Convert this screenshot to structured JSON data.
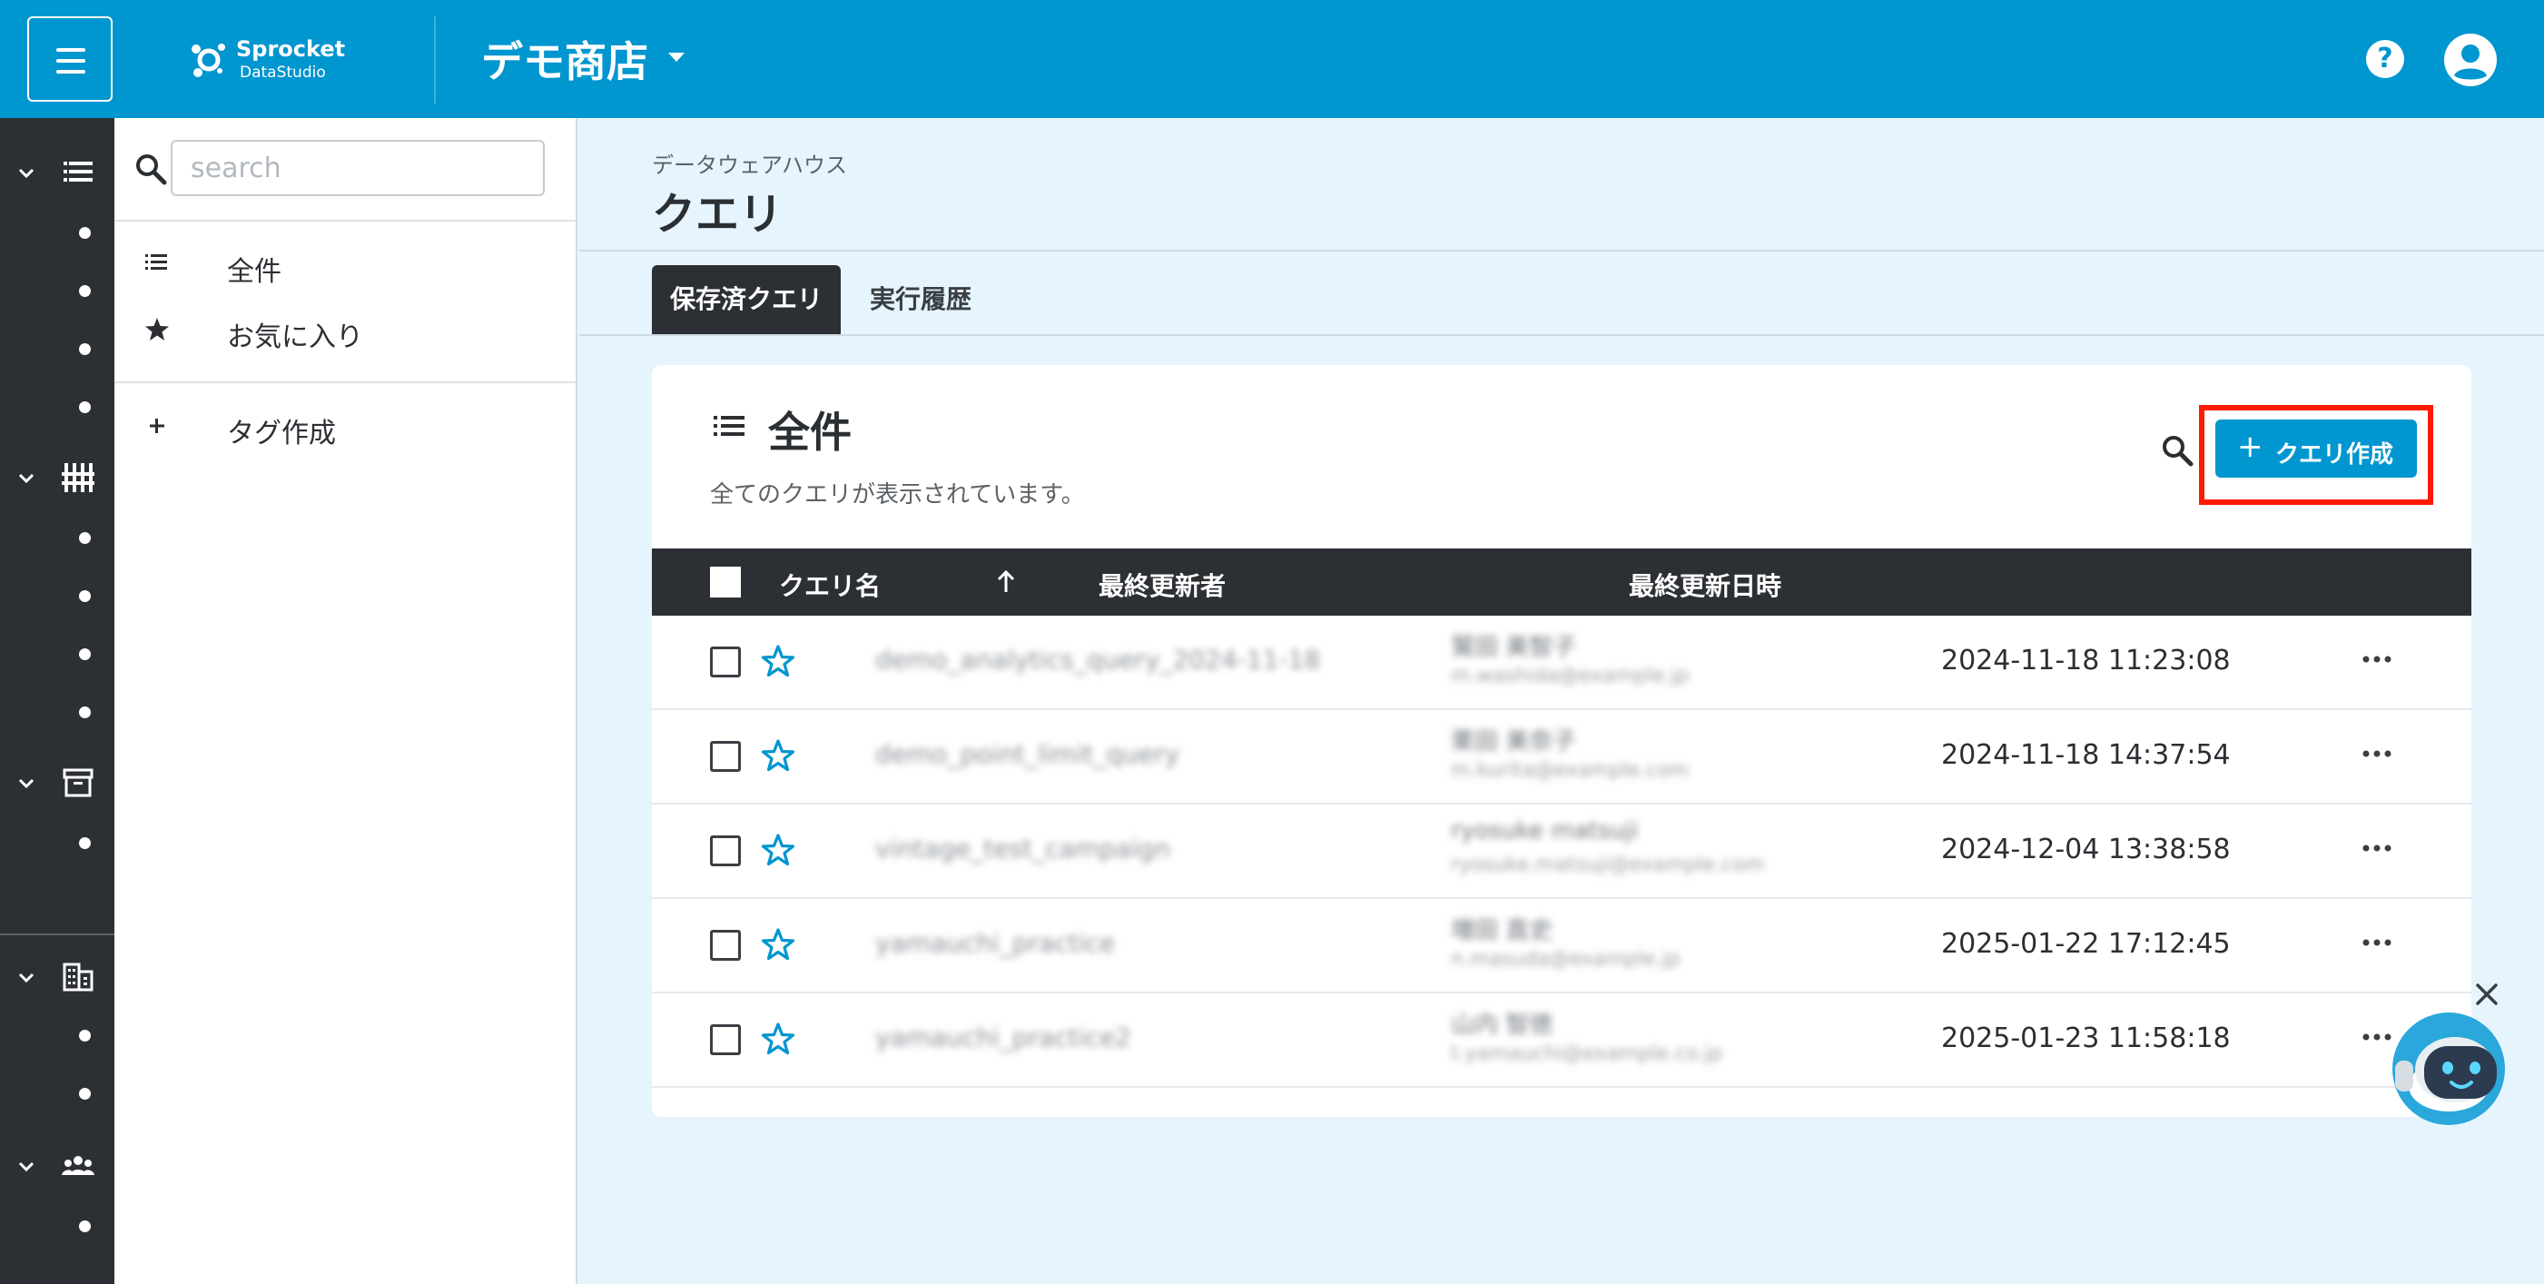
{
  "header": {
    "brand_name": "Sprocket",
    "brand_sub": "DataStudio",
    "store_name": "デモ商店",
    "help_symbol": "?"
  },
  "sidebar": {
    "search_placeholder": "search",
    "items": [
      {
        "label": "全件",
        "icon": "list-icon"
      },
      {
        "label": "お気に入り",
        "icon": "star-icon"
      },
      {
        "label": "タグ作成",
        "icon": "plus-icon"
      }
    ]
  },
  "page": {
    "breadcrumb": "データウェアハウス",
    "title": "クエリ",
    "tabs": [
      {
        "label": "保存済クエリ",
        "active": true
      },
      {
        "label": "実行履歴",
        "active": false
      }
    ]
  },
  "card": {
    "title": "全件",
    "description": "全てのクエリが表示されています。",
    "create_button": "クエリ作成",
    "columns": {
      "name": "クエリ名",
      "updated_by": "最終更新者",
      "updated_at": "最終更新日時"
    },
    "rows": [
      {
        "name": "demo_analytics_query_2024-11-18",
        "user": "鷲田 美智子",
        "email": "m.washida@example.jp",
        "updated_at": "2024-11-18 11:23:08"
      },
      {
        "name": "demo_point_limit_query",
        "user": "栗田 美奈子",
        "email": "m.kurita@example.com",
        "updated_at": "2024-11-18 14:37:54"
      },
      {
        "name": "vintage_test_campaign",
        "user": "ryosuke matsuji",
        "email": "ryosuke.matsuji@example.com",
        "updated_at": "2024-12-04 13:38:58"
      },
      {
        "name": "yamauchi_practice",
        "user": "増田 直史",
        "email": "n.masuda@example.jp",
        "updated_at": "2025-01-22 17:12:45"
      },
      {
        "name": "yamauchi_practice2",
        "user": "山内 智徳",
        "email": "t.yamauchi@example.co.jp",
        "updated_at": "2025-01-23 11:58:18"
      }
    ]
  },
  "colors": {
    "header": "#0096cf",
    "rail": "#2c3034",
    "accent": "#0096cf",
    "highlight": "#ff1a00",
    "background": "#e6f5fd"
  }
}
